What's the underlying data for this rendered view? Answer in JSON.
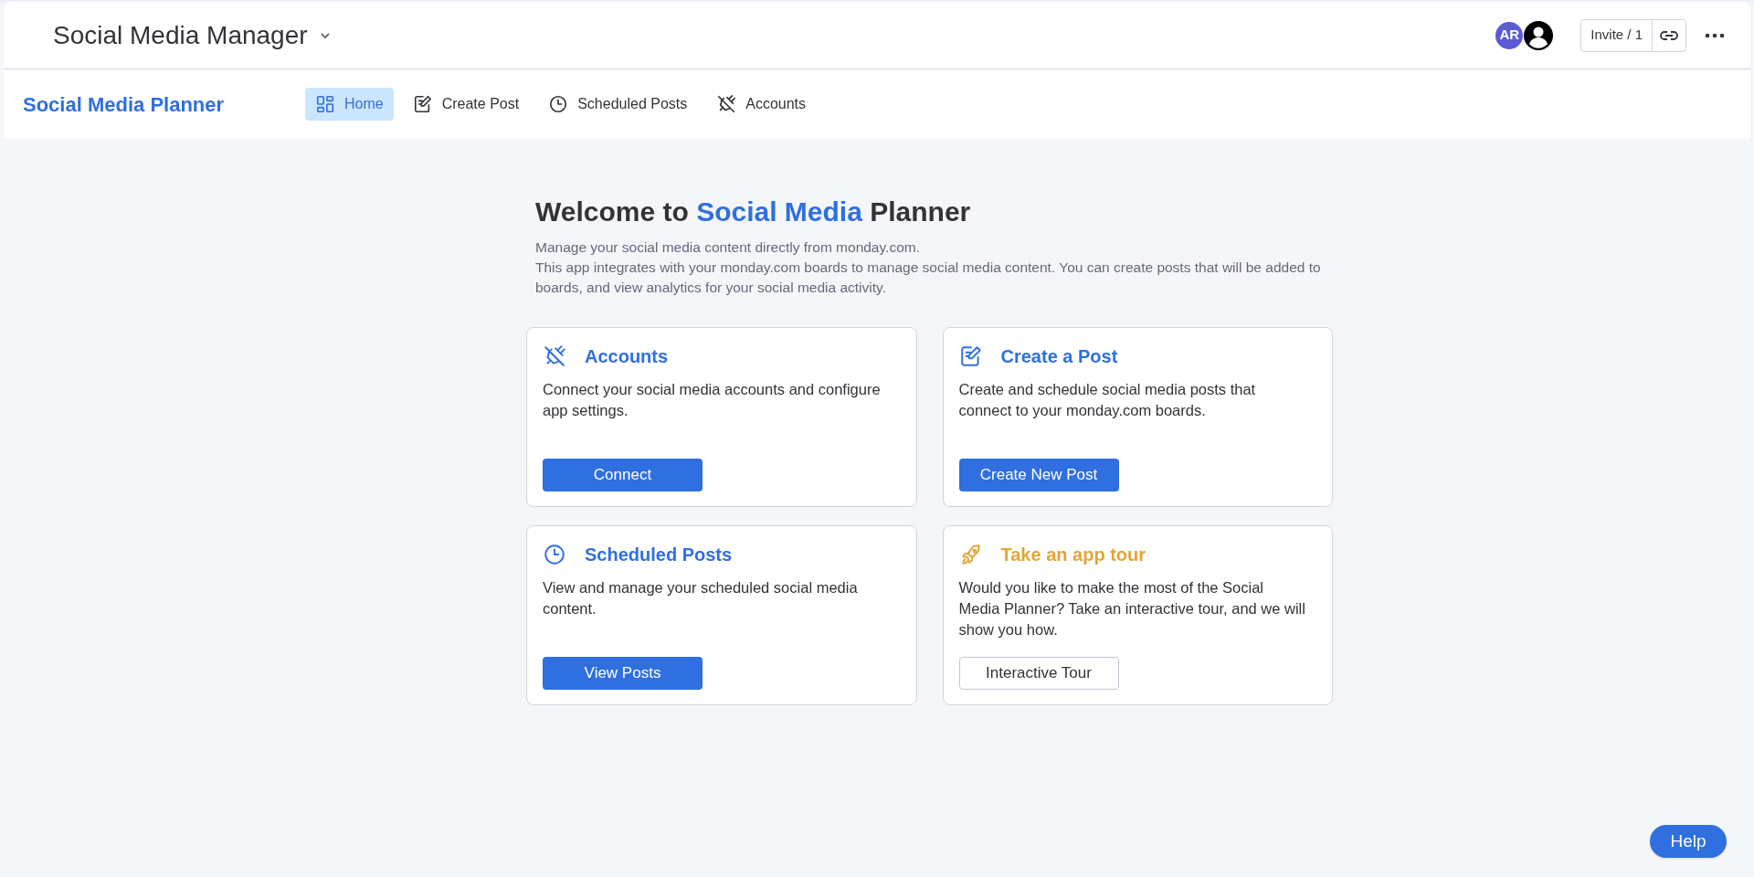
{
  "board": {
    "title": "Social Media Manager",
    "avatar_initials": "AR",
    "invite": "Invite / 1"
  },
  "app": {
    "name": "Social Media Planner",
    "tabs": [
      {
        "label": "Home",
        "kind": "grid",
        "selected": true
      },
      {
        "label": "Create Post",
        "kind": "edit",
        "selected": false
      },
      {
        "label": "Scheduled Posts",
        "kind": "clock",
        "selected": false
      },
      {
        "label": "Accounts",
        "kind": "unplug",
        "selected": false
      }
    ]
  },
  "welcome": {
    "heading": {
      "before": "Welcome to",
      "highlight": "Social Media",
      "after": "Planner"
    },
    "lines": [
      "Manage your social media content directly from monday.com.",
      "This app integrates with your monday.com boards to manage social media content. You can create posts that will be added to boards, and view analytics for your social media activity."
    ]
  },
  "cards": [
    {
      "kind": "unplug",
      "title": "Accounts",
      "color": "#2f6fe0",
      "text": "Connect your social media accounts and configure app settings.",
      "button": {
        "label": "Connect",
        "primary": true
      }
    },
    {
      "kind": "edit",
      "title": "Create a Post",
      "color": "#2f6fe0",
      "text": "Create and schedule social media posts that connect to your monday.com boards.",
      "button": {
        "label": "Create New Post",
        "primary": true
      }
    },
    {
      "kind": "clock",
      "title": "Scheduled Posts",
      "color": "#2f6fe0",
      "text": "View and manage your scheduled social media content.",
      "button": {
        "label": "View Posts",
        "primary": true
      }
    },
    {
      "kind": "rocket",
      "title": "Take an app tour",
      "color": "#e2a637",
      "text": "Would you like to make the most of the Social Media Planner? Take an interactive tour, and we will show you how.",
      "button": {
        "label": "Interactive Tour",
        "primary": false
      }
    }
  ],
  "help": "Help"
}
